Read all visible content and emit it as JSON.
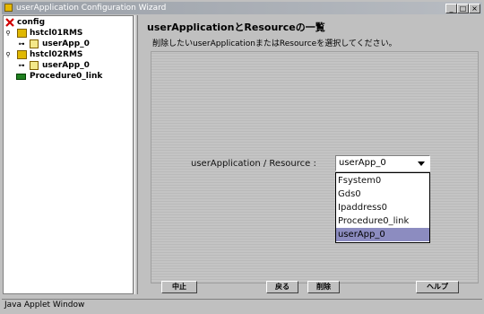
{
  "window": {
    "title": "userApplication Configuration Wizard"
  },
  "tree": {
    "root": "config",
    "nodes": [
      {
        "label": "hstcl01RMS",
        "children": [
          "userApp_0"
        ]
      },
      {
        "label": "hstcl02RMS",
        "children": [
          "userApp_0"
        ]
      }
    ],
    "link": "Procedure0_link"
  },
  "main": {
    "heading": "userApplicationとResourceの一覧",
    "instruction": "削除したいuserApplicationまたはResourceを選択してください。",
    "field_label": "userApplication / Resource  :",
    "selected_value": "userApp_0",
    "options": [
      "Fsystem0",
      "Gds0",
      "Ipaddress0",
      "Procedure0_link",
      "userApp_0"
    ]
  },
  "buttons": {
    "abort": "中止",
    "back": "戻る",
    "delete": "削除",
    "help": "ヘルプ"
  },
  "status": "Java Applet Window"
}
